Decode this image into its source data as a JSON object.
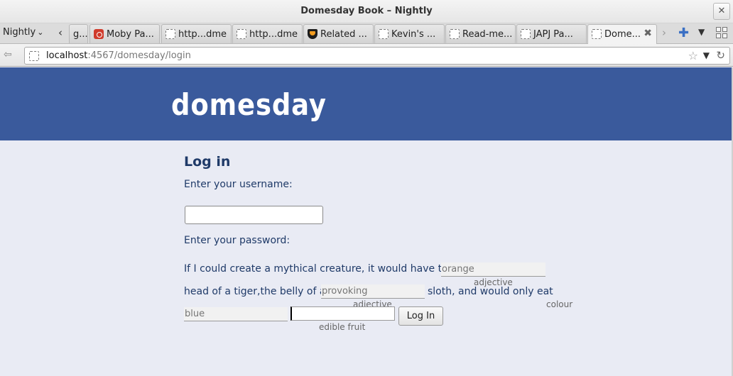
{
  "window": {
    "title": "Domesday Book – Nightly",
    "close_glyph": "✕"
  },
  "tabbar": {
    "menu_label": "Nightly",
    "tabs": [
      {
        "label": "g...",
        "icon": "blank-page-icon"
      },
      {
        "label": "Moby Pa...",
        "icon": "moby-icon"
      },
      {
        "label": "http...dme",
        "icon": "blank-page-icon"
      },
      {
        "label": "http...dme",
        "icon": "blank-page-icon"
      },
      {
        "label": "Related ...",
        "icon": "shield-icon"
      },
      {
        "label": "Kevin's ...",
        "icon": "blank-page-icon"
      },
      {
        "label": "Read-me...",
        "icon": "blank-page-icon"
      },
      {
        "label": "JAPJ Pa...",
        "icon": "blank-page-icon"
      },
      {
        "label": "Dome...",
        "icon": "blank-page-icon",
        "active": true
      }
    ]
  },
  "navbar": {
    "url_host": "localhost",
    "url_path": ":4567/domesday/login"
  },
  "page": {
    "logo": "domesday",
    "heading": "Log in",
    "username_prompt": "Enter your username:",
    "password_prompt": "Enter your password:",
    "sentence": {
      "part1": "If I could create a mythical creature, it would have the",
      "part2": "head of a tiger,the belly of a",
      "part3": "sloth, and would only eat"
    },
    "blanks": [
      {
        "placeholder": "orange",
        "hint": "adjective"
      },
      {
        "placeholder": "provoking",
        "hint": "adjective"
      },
      {
        "placeholder": "",
        "hint": "colour"
      },
      {
        "placeholder": "blue",
        "hint": ""
      },
      {
        "placeholder": "",
        "hint": "edible fruit"
      }
    ],
    "login_button": "Log In"
  },
  "colors": {
    "header": "#3a5a9c",
    "page_bg": "#e9ebf4",
    "text": "#1f3a68"
  }
}
